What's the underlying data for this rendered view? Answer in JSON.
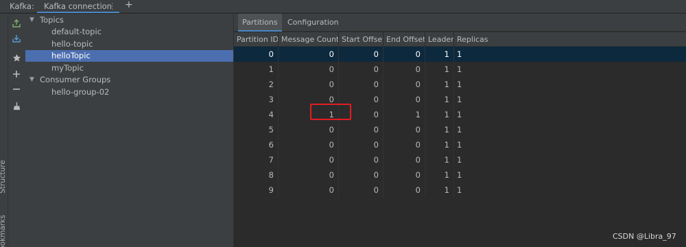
{
  "topbar": {
    "app_label": "Kafka:",
    "tab_label": "Kafka connection",
    "tab_menu": "⋮",
    "add_label": "+"
  },
  "side_strip": {
    "structure_label": "Structure",
    "bookmarks_label": "Bookmarks"
  },
  "toolbar": {
    "icons": [
      "export-icon",
      "import-icon",
      "star-icon",
      "add-icon",
      "remove-icon",
      "broom-icon"
    ]
  },
  "tree": {
    "topics_label": "Topics",
    "topics": [
      "default-topic",
      "hello-topic",
      "helloTopic",
      "myTopic"
    ],
    "selected_topic": "helloTopic",
    "groups_label": "Consumer Groups",
    "groups": [
      "hello-group-02"
    ]
  },
  "subtabs": {
    "partitions": "Partitions",
    "configuration": "Configuration",
    "active": "Partitions"
  },
  "table": {
    "columns": [
      "Partition ID",
      "Message Count",
      "Start Offset",
      "End Offset",
      "Leader",
      "Replicas"
    ],
    "rows": [
      [
        "0",
        "0",
        "0",
        "0",
        "1",
        "1"
      ],
      [
        "1",
        "0",
        "0",
        "0",
        "1",
        "1"
      ],
      [
        "2",
        "0",
        "0",
        "0",
        "1",
        "1"
      ],
      [
        "3",
        "0",
        "0",
        "0",
        "1",
        "1"
      ],
      [
        "4",
        "1",
        "0",
        "1",
        "1",
        "1"
      ],
      [
        "5",
        "0",
        "0",
        "0",
        "1",
        "1"
      ],
      [
        "6",
        "0",
        "0",
        "0",
        "1",
        "1"
      ],
      [
        "7",
        "0",
        "0",
        "0",
        "1",
        "1"
      ],
      [
        "8",
        "0",
        "0",
        "0",
        "1",
        "1"
      ],
      [
        "9",
        "0",
        "0",
        "0",
        "1",
        "1"
      ]
    ],
    "selected_row": 0
  },
  "colors": {
    "accent": "#4a88c7",
    "selection": "#4b6eaf",
    "highlight_box": "#e51c23"
  },
  "watermark": "CSDN @Libra_97"
}
